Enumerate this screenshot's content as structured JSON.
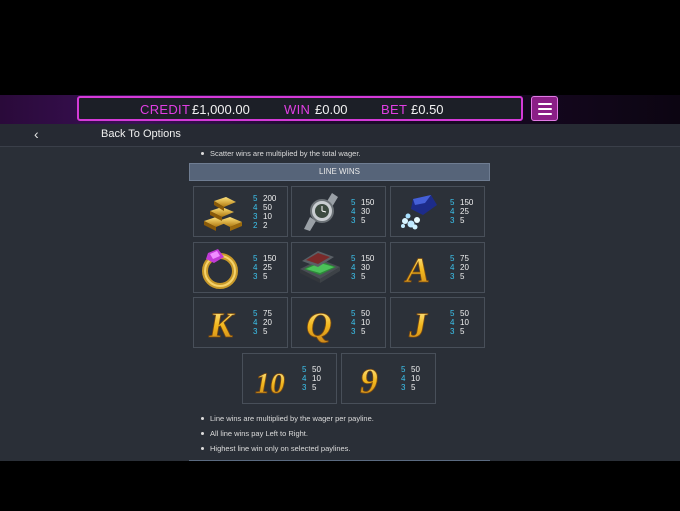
{
  "header": {
    "credit_label": "CREDIT",
    "credit_value": "£1,000.00",
    "win_label": "WIN",
    "win_value": "£0.00",
    "bet_label": "BET",
    "bet_value": "£0.50",
    "menu_icon": "hamburger-menu-icon"
  },
  "nav": {
    "back_arrow": "‹",
    "back_label": "Back To Options"
  },
  "notes_top": [
    "Scatter wins are multiplied by the total wager."
  ],
  "section_title": "LINE WINS",
  "symbols": [
    {
      "name": "gold-bars",
      "icon": "gold-bars-icon",
      "pays": [
        {
          "count": "5",
          "pay": "200"
        },
        {
          "count": "4",
          "pay": "50"
        },
        {
          "count": "3",
          "pay": "10"
        },
        {
          "count": "2",
          "pay": "2"
        }
      ]
    },
    {
      "name": "watch",
      "icon": "watch-icon",
      "pays": [
        {
          "count": "5",
          "pay": "150"
        },
        {
          "count": "4",
          "pay": "30"
        },
        {
          "count": "3",
          "pay": "5"
        }
      ]
    },
    {
      "name": "gems",
      "icon": "gems-icon",
      "pays": [
        {
          "count": "5",
          "pay": "150"
        },
        {
          "count": "4",
          "pay": "25"
        },
        {
          "count": "3",
          "pay": "5"
        }
      ]
    },
    {
      "name": "ring",
      "icon": "ring-icon",
      "pays": [
        {
          "count": "5",
          "pay": "150"
        },
        {
          "count": "4",
          "pay": "25"
        },
        {
          "count": "3",
          "pay": "5"
        }
      ]
    },
    {
      "name": "cash-case",
      "icon": "cash-case-icon",
      "pays": [
        {
          "count": "5",
          "pay": "150"
        },
        {
          "count": "4",
          "pay": "30"
        },
        {
          "count": "3",
          "pay": "5"
        }
      ]
    },
    {
      "name": "A",
      "icon": "letter-a-icon",
      "glyph": "A",
      "pays": [
        {
          "count": "5",
          "pay": "75"
        },
        {
          "count": "4",
          "pay": "20"
        },
        {
          "count": "3",
          "pay": "5"
        }
      ]
    },
    {
      "name": "K",
      "icon": "letter-k-icon",
      "glyph": "K",
      "pays": [
        {
          "count": "5",
          "pay": "75"
        },
        {
          "count": "4",
          "pay": "20"
        },
        {
          "count": "3",
          "pay": "5"
        }
      ]
    },
    {
      "name": "Q",
      "icon": "letter-q-icon",
      "glyph": "Q",
      "pays": [
        {
          "count": "5",
          "pay": "50"
        },
        {
          "count": "4",
          "pay": "10"
        },
        {
          "count": "3",
          "pay": "5"
        }
      ]
    },
    {
      "name": "J",
      "icon": "letter-j-icon",
      "glyph": "J",
      "pays": [
        {
          "count": "5",
          "pay": "50"
        },
        {
          "count": "4",
          "pay": "10"
        },
        {
          "count": "3",
          "pay": "5"
        }
      ]
    },
    {
      "name": "10",
      "icon": "number-10-icon",
      "glyph": "10",
      "pays": [
        {
          "count": "5",
          "pay": "50"
        },
        {
          "count": "4",
          "pay": "10"
        },
        {
          "count": "3",
          "pay": "5"
        }
      ]
    },
    {
      "name": "9",
      "icon": "number-9-icon",
      "glyph": "9",
      "pays": [
        {
          "count": "5",
          "pay": "50"
        },
        {
          "count": "4",
          "pay": "10"
        },
        {
          "count": "3",
          "pay": "5"
        }
      ]
    }
  ],
  "notes_bottom": [
    "Line wins are multiplied by the wager per payline.",
    "All line wins pay Left to Right.",
    "Highest line win only on selected paylines."
  ],
  "colors": {
    "accent": "#e03ee3",
    "pay_count": "#3cc4ef",
    "panel": "#2a2f37"
  }
}
